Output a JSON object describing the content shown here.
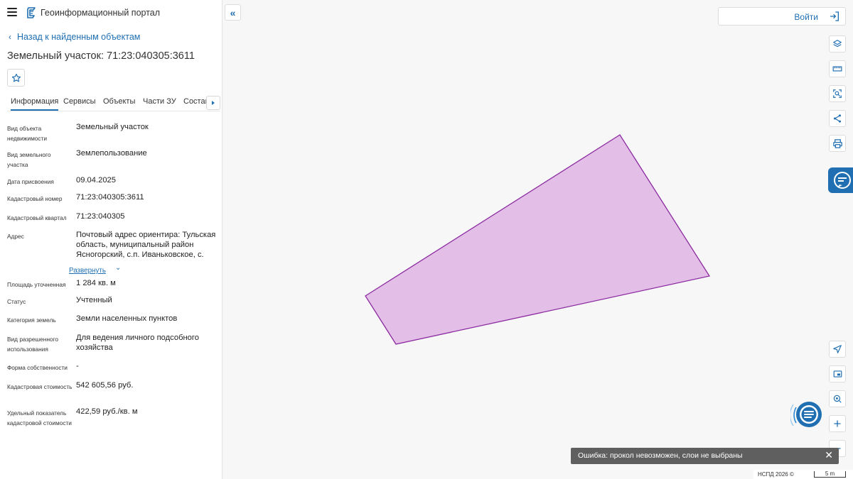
{
  "header": {
    "app_title": "Геоинформационный портал"
  },
  "nav": {
    "back_label": "Назад к найденным объектам"
  },
  "object": {
    "title": "Земельный участок: 71:23:040305:3611"
  },
  "tabs": [
    {
      "label": "Информация",
      "active": true
    },
    {
      "label": "Сервисы",
      "active": false
    },
    {
      "label": "Объекты",
      "active": false
    },
    {
      "label": "Части ЗУ",
      "active": false
    },
    {
      "label": "Состав",
      "active": false
    }
  ],
  "fields": [
    {
      "label": "Вид объекта недвижимости",
      "value": "Земельный участок"
    },
    {
      "label": "Вид земельного участка",
      "value": "Землепользование"
    },
    {
      "label": "Дата присвоения",
      "value": "09.04.2025"
    },
    {
      "label": "Кадастровый номер",
      "value": "71:23:040305:3611"
    },
    {
      "label": "Кадастровый квартал",
      "value": "71:23:040305"
    },
    {
      "label": "Адрес",
      "value": "Почтовый адрес ориентира: Тульская область, муниципальный район Ясногорский, с.п. Иваньковское, с."
    },
    {
      "label": "Площадь уточненная",
      "value": "1 284 кв. м"
    },
    {
      "label": "Статус",
      "value": "Учтенный"
    },
    {
      "label": "Категория земель",
      "value": "Земли населенных пунктов"
    },
    {
      "label": "Вид разрешенного использования",
      "value": "Для ведения личного подсобного хозяйства"
    },
    {
      "label": "Форма собственности",
      "value": "-"
    },
    {
      "label": "Кадастровая стоимость",
      "value": "542 605,56 руб."
    },
    {
      "label": "Удельный показатель кадастровой стоимости",
      "value": "422,59 руб./кв. м"
    }
  ],
  "address_expand_label": "Развернуть",
  "map": {
    "login_label": "Войти",
    "toast_message": "Ошибка: прокол невозможен, слои не выбраны",
    "copyright": "НСПД 2026 ©",
    "scale_label": "5 m",
    "parcel_fill": "#e3bfe8",
    "parcel_stroke": "#8b2aa0"
  },
  "colors": {
    "accent": "#1f6fb2"
  }
}
